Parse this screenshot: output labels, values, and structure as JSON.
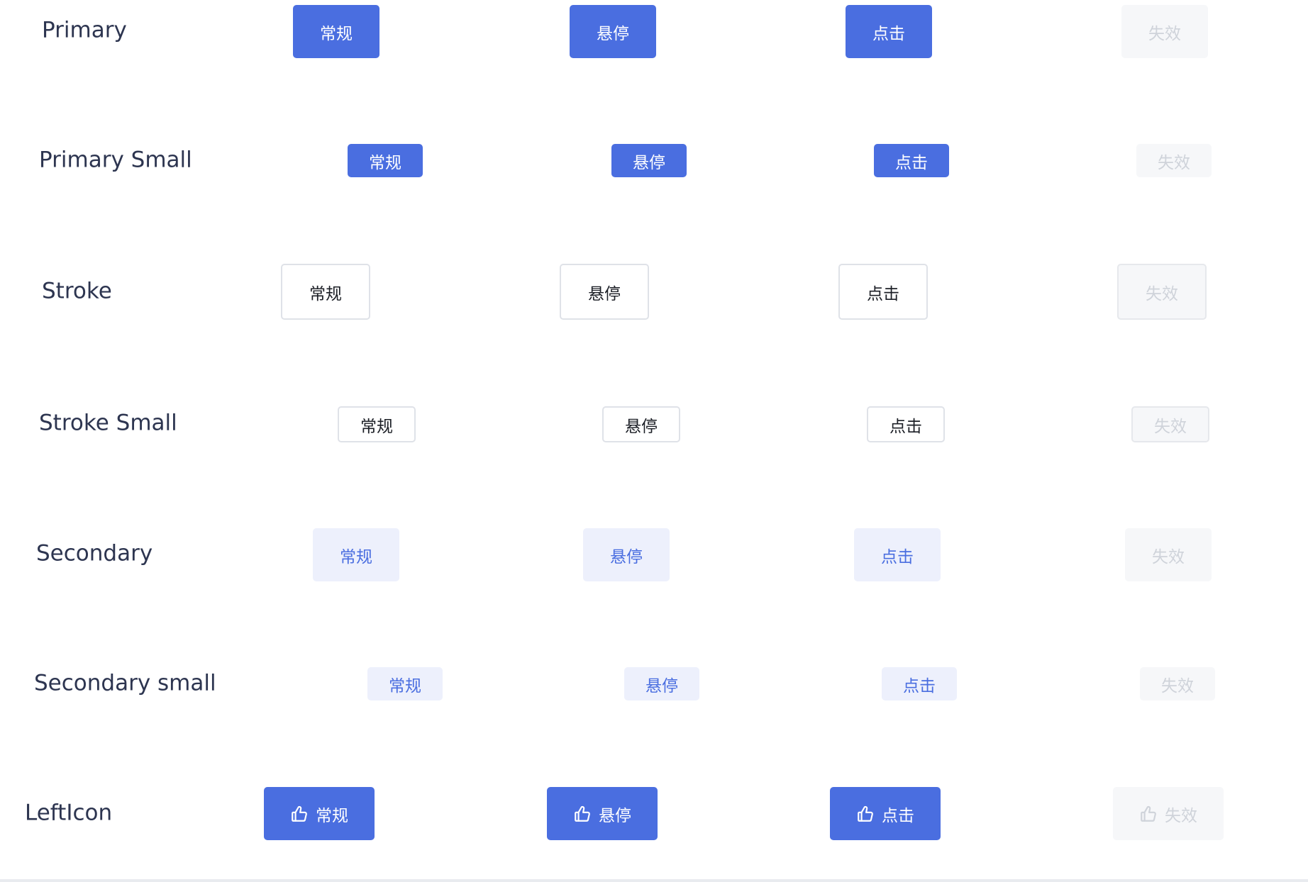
{
  "rows": [
    {
      "label": "Primary",
      "buttons": [
        {
          "state": "normal",
          "label": "常规"
        },
        {
          "state": "hover",
          "label": "悬停"
        },
        {
          "state": "active",
          "label": "点击"
        },
        {
          "state": "disabled",
          "label": "失效"
        }
      ]
    },
    {
      "label": "Primary Small",
      "buttons": [
        {
          "state": "normal",
          "label": "常规"
        },
        {
          "state": "hover",
          "label": "悬停"
        },
        {
          "state": "active",
          "label": "点击"
        },
        {
          "state": "disabled",
          "label": "失效"
        }
      ]
    },
    {
      "label": "Stroke",
      "buttons": [
        {
          "state": "normal",
          "label": "常规"
        },
        {
          "state": "hover",
          "label": "悬停"
        },
        {
          "state": "active",
          "label": "点击"
        },
        {
          "state": "disabled",
          "label": "失效"
        }
      ]
    },
    {
      "label": "Stroke Small",
      "buttons": [
        {
          "state": "normal",
          "label": "常规"
        },
        {
          "state": "hover",
          "label": "悬停"
        },
        {
          "state": "active",
          "label": "点击"
        },
        {
          "state": "disabled",
          "label": "失效"
        }
      ]
    },
    {
      "label": "Secondary",
      "buttons": [
        {
          "state": "normal",
          "label": "常规"
        },
        {
          "state": "hover",
          "label": "悬停"
        },
        {
          "state": "active",
          "label": "点击"
        },
        {
          "state": "disabled",
          "label": "失效"
        }
      ]
    },
    {
      "label": "Secondary small",
      "buttons": [
        {
          "state": "normal",
          "label": "常规"
        },
        {
          "state": "hover",
          "label": "悬停"
        },
        {
          "state": "active",
          "label": "点击"
        },
        {
          "state": "disabled",
          "label": "失效"
        }
      ]
    },
    {
      "label": "LeftIcon",
      "icon": "thumbs-up-icon",
      "buttons": [
        {
          "state": "normal",
          "label": "常规"
        },
        {
          "state": "hover",
          "label": "悬停"
        },
        {
          "state": "active",
          "label": "点击"
        },
        {
          "state": "disabled",
          "label": "失效"
        }
      ]
    }
  ],
  "colors": {
    "primary": "#4a6ee0",
    "secondary_bg": "#edf0fc",
    "disabled_bg": "#f6f7f9",
    "disabled_text": "#cfd3da",
    "stroke_border": "#dfe2e8",
    "label_text": "#2d3550"
  }
}
